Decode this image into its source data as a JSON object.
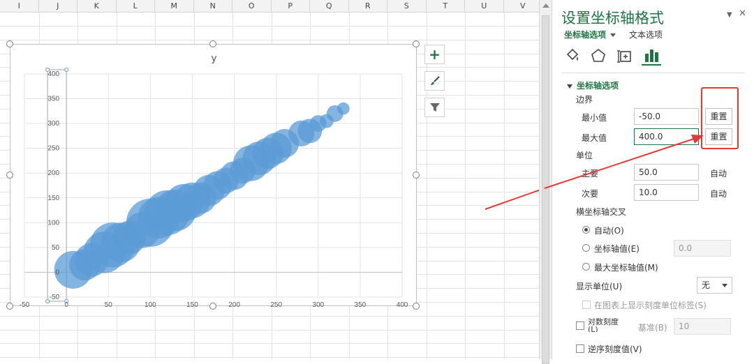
{
  "spreadsheet": {
    "columns": [
      "I",
      "J",
      "K",
      "L",
      "M",
      "N",
      "O",
      "P",
      "Q",
      "R",
      "S",
      "T",
      "U",
      "V"
    ]
  },
  "chart": {
    "chart_title": "y",
    "buttons": [
      {
        "name": "add-element-button",
        "icon": "plus-icon"
      },
      {
        "name": "chart-styles-button",
        "icon": "brush-icon"
      },
      {
        "name": "chart-filters-button",
        "icon": "filter-icon"
      }
    ]
  },
  "chart_data": {
    "type": "scatter",
    "subtype": "bubble",
    "title": "y",
    "xlabel": "",
    "ylabel": "",
    "xlim": [
      -50,
      400
    ],
    "ylim": [
      -50,
      400
    ],
    "x_ticks": [
      "-50",
      "0",
      "50",
      "100",
      "150",
      "200",
      "250",
      "300",
      "350",
      "400"
    ],
    "y_ticks": [
      "-50",
      "0",
      "50",
      "100",
      "150",
      "200",
      "250",
      "300",
      "350",
      "400"
    ],
    "grid": true,
    "color": "#5b9bd5",
    "bubbles": [
      {
        "x": 8,
        "y": 5,
        "size": 18
      },
      {
        "x": 22,
        "y": 15,
        "size": 12
      },
      {
        "x": 30,
        "y": 25,
        "size": 14
      },
      {
        "x": 45,
        "y": 40,
        "size": 22
      },
      {
        "x": 55,
        "y": 55,
        "size": 26
      },
      {
        "x": 65,
        "y": 60,
        "size": 20
      },
      {
        "x": 75,
        "y": 70,
        "size": 14
      },
      {
        "x": 90,
        "y": 85,
        "size": 16
      },
      {
        "x": 100,
        "y": 100,
        "size": 30
      },
      {
        "x": 110,
        "y": 110,
        "size": 22
      },
      {
        "x": 120,
        "y": 120,
        "size": 26
      },
      {
        "x": 130,
        "y": 125,
        "size": 22
      },
      {
        "x": 140,
        "y": 140,
        "size": 18
      },
      {
        "x": 150,
        "y": 145,
        "size": 16
      },
      {
        "x": 160,
        "y": 150,
        "size": 12
      },
      {
        "x": 170,
        "y": 165,
        "size": 12
      },
      {
        "x": 180,
        "y": 175,
        "size": 10
      },
      {
        "x": 190,
        "y": 185,
        "size": 8
      },
      {
        "x": 200,
        "y": 195,
        "size": 10
      },
      {
        "x": 210,
        "y": 205,
        "size": 8
      },
      {
        "x": 220,
        "y": 220,
        "size": 16
      },
      {
        "x": 230,
        "y": 230,
        "size": 14
      },
      {
        "x": 240,
        "y": 240,
        "size": 12
      },
      {
        "x": 250,
        "y": 250,
        "size": 12
      },
      {
        "x": 260,
        "y": 260,
        "size": 10
      },
      {
        "x": 280,
        "y": 280,
        "size": 8
      },
      {
        "x": 290,
        "y": 285,
        "size": 7
      },
      {
        "x": 300,
        "y": 300,
        "size": 3
      },
      {
        "x": 310,
        "y": 305,
        "size": 2
      },
      {
        "x": 320,
        "y": 320,
        "size": 3
      },
      {
        "x": 330,
        "y": 330,
        "size": 1.5
      }
    ]
  },
  "panel": {
    "title": "设置坐标轴格式",
    "tabs": {
      "axis_options": "坐标轴选项",
      "text_options": "文本选项"
    },
    "icon_tabs": [
      "fill-line-icon",
      "effects-icon",
      "size-properties-icon",
      "axis-options-icon"
    ],
    "section_title": "坐标轴选项",
    "bounds_label": "边界",
    "min_label": "最小值",
    "min_value": "-50.0",
    "max_label": "最大值",
    "max_value": "400.0",
    "reset_label": "重置",
    "units_label": "单位",
    "major_label": "主要",
    "major_value": "50.0",
    "minor_label": "次要",
    "minor_value": "10.0",
    "auto_label": "自动",
    "cross_label": "横坐标轴交叉",
    "cross_auto": "自动(O)",
    "cross_value_label": "坐标轴值(E)",
    "cross_value": "0.0",
    "cross_max": "最大坐标轴值(M)",
    "display_unit_label": "显示单位(U)",
    "display_unit_value": "无",
    "show_unit_label": "在图表上显示刻度单位标签(S)",
    "log_label": "对数刻度\n(L)",
    "base_label": "基准(B)",
    "base_value": "10",
    "reverse_label": "逆序刻度值(V)"
  },
  "colors": {
    "accent": "#217346",
    "bubble": "#5b9bd5",
    "annotation": "#e53935"
  }
}
